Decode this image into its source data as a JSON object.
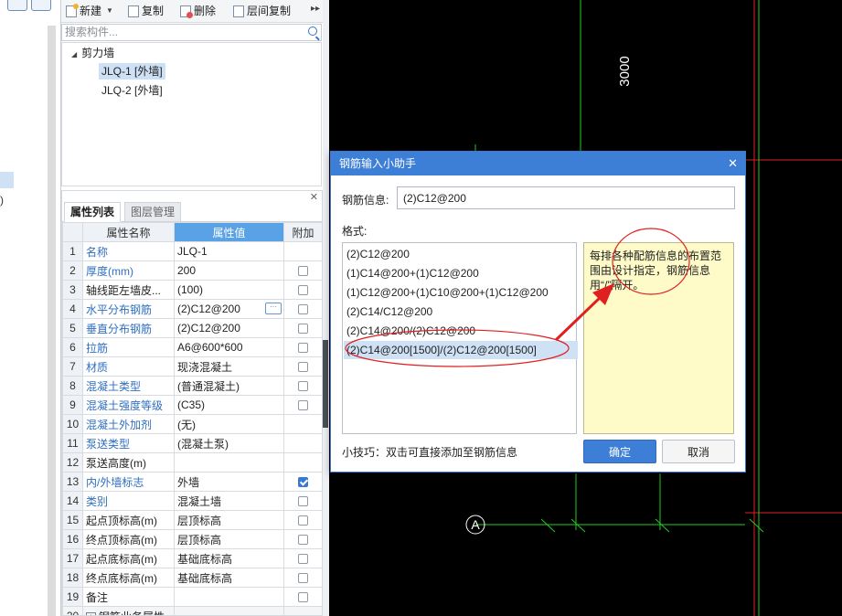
{
  "toolbar": {
    "new_label": "新建",
    "copy_label": "复制",
    "delete_label": "删除",
    "layer_copy_label": "层间复制",
    "more_glyph": "▸▸"
  },
  "search": {
    "placeholder": "搜索构件..."
  },
  "tree": {
    "parent": "剪力墙",
    "children": [
      "JLQ-1 [外墙]",
      "JLQ-2 [外墙]"
    ],
    "selected_index": 0
  },
  "properties": {
    "tabs": [
      "属性列表",
      "图层管理"
    ],
    "active_tab": "属性列表",
    "columns": [
      "属性名称",
      "属性值",
      "附加"
    ],
    "rows": [
      {
        "num": "1",
        "name": "名称",
        "value": "JLQ-1",
        "blue": true,
        "checkbox": false
      },
      {
        "num": "2",
        "name": "厚度(mm)",
        "value": "200",
        "blue": true,
        "checkbox": true,
        "checked": false
      },
      {
        "num": "3",
        "name": "轴线距左墙皮...",
        "value": "(100)",
        "blue": false,
        "checkbox": true,
        "checked": false
      },
      {
        "num": "4",
        "name": "水平分布钢筋",
        "value": "(2)C12@200",
        "blue": true,
        "checkbox": true,
        "checked": false,
        "selected": true
      },
      {
        "num": "5",
        "name": "垂直分布钢筋",
        "value": "(2)C12@200",
        "blue": true,
        "checkbox": true,
        "checked": false
      },
      {
        "num": "6",
        "name": "拉筋",
        "value": "A6@600*600",
        "blue": true,
        "checkbox": true,
        "checked": false
      },
      {
        "num": "7",
        "name": "材质",
        "value": "现浇混凝土",
        "blue": true,
        "checkbox": true,
        "checked": false
      },
      {
        "num": "8",
        "name": "混凝土类型",
        "value": "(普通混凝土)",
        "blue": true,
        "checkbox": true,
        "checked": false
      },
      {
        "num": "9",
        "name": "混凝土强度等级",
        "value": "(C35)",
        "blue": true,
        "checkbox": true,
        "checked": false
      },
      {
        "num": "10",
        "name": "混凝土外加剂",
        "value": "(无)",
        "blue": true,
        "checkbox": false
      },
      {
        "num": "11",
        "name": "泵送类型",
        "value": "(混凝土泵)",
        "blue": true,
        "checkbox": false
      },
      {
        "num": "12",
        "name": "泵送高度(m)",
        "value": "",
        "blue": false,
        "checkbox": false
      },
      {
        "num": "13",
        "name": "内/外墙标志",
        "value": "外墙",
        "blue": true,
        "checkbox": true,
        "checked": true
      },
      {
        "num": "14",
        "name": "类别",
        "value": "混凝土墙",
        "blue": true,
        "checkbox": true,
        "checked": false
      },
      {
        "num": "15",
        "name": "起点顶标高(m)",
        "value": "层顶标高",
        "blue": false,
        "checkbox": true,
        "checked": false
      },
      {
        "num": "16",
        "name": "终点顶标高(m)",
        "value": "层顶标高",
        "blue": false,
        "checkbox": true,
        "checked": false
      },
      {
        "num": "17",
        "name": "起点底标高(m)",
        "value": "基础底标高",
        "blue": false,
        "checkbox": true,
        "checked": false
      },
      {
        "num": "18",
        "name": "终点底标高(m)",
        "value": "基础底标高",
        "blue": false,
        "checkbox": true,
        "checked": false
      },
      {
        "num": "19",
        "name": "备注",
        "value": "",
        "blue": false,
        "checkbox": true,
        "checked": false
      },
      {
        "num": "20",
        "name": "钢筋业务属性",
        "value": "",
        "blue": false,
        "checkbox": false,
        "group": true
      }
    ],
    "left_paren": ")"
  },
  "canvas": {
    "dimension_text": "3000",
    "axis_label": "A"
  },
  "dialog": {
    "title": "钢筋输入小助手",
    "close_glyph": "✕",
    "rebar_label": "钢筋信息:",
    "rebar_value": "(2)C12@200",
    "format_label": "格式:",
    "formats": [
      "(2)C12@200",
      "(1)C14@200+(1)C12@200",
      "(1)C12@200+(1)C10@200+(1)C12@200",
      "(2)C14/C12@200",
      "(2)C14@200/(2)C12@200",
      "(2)C14@200[1500]/(2)C12@200[1500]"
    ],
    "selected_format_index": 5,
    "hint": "每排各种配筋信息的布置范围由设计指定，钢筋信息用“/”隔开。",
    "tip": "小技巧：双击可直接添加至钢筋信息",
    "ok_label": "确定",
    "cancel_label": "取消"
  },
  "colors": {
    "accent": "#3d7fd6",
    "header_blue": "#5aa2e6",
    "link_blue": "#2f6fc0",
    "cad_green": "#22cc22",
    "cad_red": "#e02020",
    "annotation_red": "#e02020",
    "hint_bg": "#fefbc8"
  },
  "icons": [
    "new-icon",
    "copy-icon",
    "delete-icon",
    "layer-copy-icon",
    "search-icon",
    "close-icon",
    "ellipsis-icon",
    "checkbox-icon",
    "expand-icon"
  ]
}
